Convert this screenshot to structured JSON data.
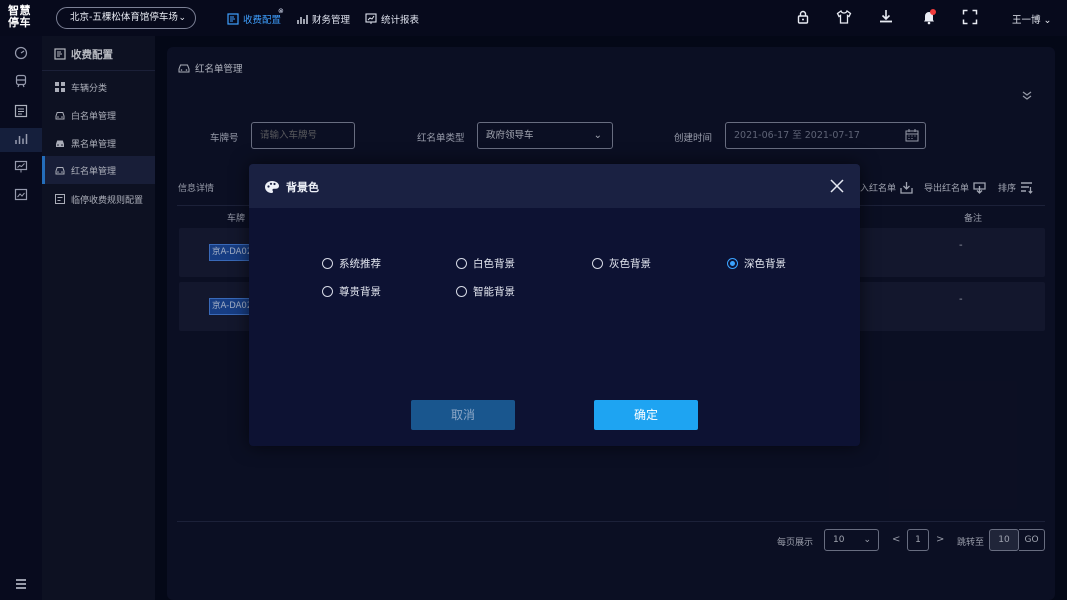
{
  "logo": "智慧停车",
  "parking_lot": "北京-五棵松体育馆停车场",
  "topnav": [
    {
      "label": "收费配置"
    },
    {
      "label": "财务管理"
    },
    {
      "label": "统计报表"
    }
  ],
  "user_name": "王一博",
  "submenu": {
    "title": "收费配置",
    "items": [
      {
        "label": "车辆分类"
      },
      {
        "label": "白名单管理"
      },
      {
        "label": "黑名单管理"
      },
      {
        "label": "红名单管理"
      },
      {
        "label": "临停收费规则配置"
      }
    ]
  },
  "page": {
    "title": "红名单管理",
    "filters": {
      "plate_label": "车牌号",
      "plate_placeholder": "请输入车牌号",
      "type_label": "红名单类型",
      "type_value": "政府领导车",
      "time_label": "创建时间",
      "time_value": "2021-06-17 至 2021-07-17"
    },
    "info_label": "信息详情",
    "actions": {
      "import": "入红名单",
      "export": "导出红名单",
      "sort": "排序"
    },
    "columns": {
      "plate": "车牌",
      "remark": "备注"
    },
    "rows": [
      {
        "plate": "京A-DA02",
        "remark": "-"
      },
      {
        "plate": "京A-DA02",
        "remark": "-"
      }
    ],
    "pagination": {
      "per_page_label": "每页展示",
      "per_page": "10",
      "current_page": "1",
      "prev": "<",
      "next": ">",
      "jump_label": "跳转至",
      "jump_value": "10",
      "go": "GO"
    }
  },
  "modal": {
    "title": "背景色",
    "options": [
      {
        "label": "系统推荐"
      },
      {
        "label": "白色背景"
      },
      {
        "label": "灰色背景"
      },
      {
        "label": "深色背景"
      },
      {
        "label": "尊贵背景"
      },
      {
        "label": "智能背景"
      }
    ],
    "selected": "深色背景",
    "cancel": "取消",
    "confirm": "确定"
  },
  "colors": {
    "accent": "#1ea4f2",
    "active_nav": "#3fa0ff",
    "background": "#050817"
  }
}
